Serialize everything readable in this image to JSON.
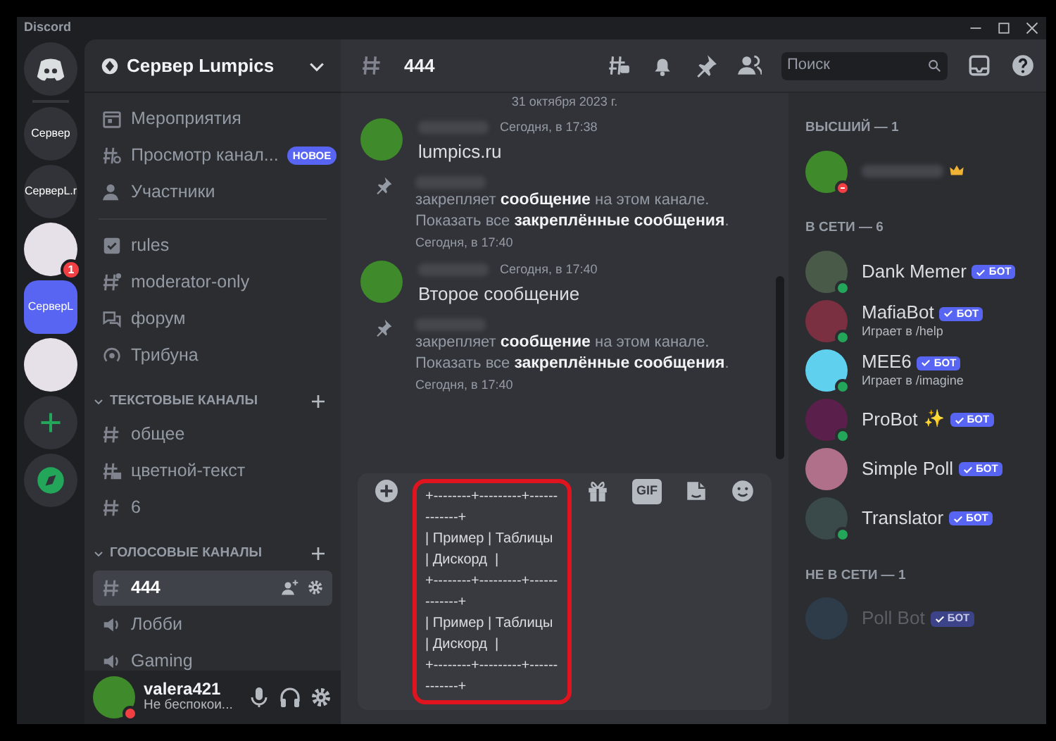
{
  "window": {
    "title": "Discord"
  },
  "servers": [
    {
      "kind": "home",
      "selected": false
    },
    {
      "kind": "text",
      "label": "Сервер",
      "selected": false
    },
    {
      "kind": "text",
      "label": "СерверL.r",
      "selected": false
    },
    {
      "kind": "image",
      "badge": "1",
      "selected": false
    },
    {
      "kind": "text",
      "label": "СерверL",
      "selected": true
    },
    {
      "kind": "image",
      "selected": false
    },
    {
      "kind": "add",
      "selected": false
    },
    {
      "kind": "explore",
      "selected": false
    }
  ],
  "server_header": {
    "name": "Сервер Lumpics"
  },
  "nav_items": [
    {
      "kind": "calendar",
      "label": "Мероприятия"
    },
    {
      "kind": "browse",
      "label": "Просмотр канал...",
      "badge": "НОВОЕ"
    },
    {
      "kind": "members",
      "label": "Участники"
    }
  ],
  "channels": [
    {
      "kind": "rules",
      "label": "rules",
      "selected": false
    },
    {
      "kind": "hidden",
      "label": "moderator-only",
      "selected": false
    },
    {
      "kind": "forum",
      "label": "форум",
      "selected": false
    },
    {
      "kind": "stage",
      "label": "Трибуна",
      "selected": false
    }
  ],
  "categories": [
    {
      "label": "ТЕКСТОВЫЕ КАНАЛЫ",
      "channels": [
        {
          "kind": "text",
          "label": "общее",
          "selected": false
        },
        {
          "kind": "locked",
          "label": "цветной-текст",
          "selected": false
        },
        {
          "kind": "text",
          "label": "6",
          "selected": false
        }
      ]
    },
    {
      "label": "ГОЛОСОВЫЕ КАНАЛЫ",
      "channels": [
        {
          "kind": "text",
          "label": "444",
          "selected": true
        },
        {
          "kind": "voice",
          "label": "Лобби",
          "selected": false
        },
        {
          "kind": "voice",
          "label": "Gaming",
          "selected": false
        }
      ]
    }
  ],
  "user_panel": {
    "name": "valera421",
    "status": "Не беспокои...",
    "dnd": true
  },
  "chat_header": {
    "channel": "444",
    "search_placeholder": "Поиск"
  },
  "date_divider": "31 октября 2023 г.",
  "messages": [
    {
      "kind": "message",
      "time": "Сегодня, в 17:38",
      "text": "lumpics.ru"
    },
    {
      "kind": "pin",
      "text": "закрепляет **сообщение** на этом канале. Показать все **закреплённые сообщения**.",
      "time": "Сегодня, в 17:40"
    },
    {
      "kind": "message",
      "time": "Сегодня, в 17:40",
      "text": "Второе сообщение"
    },
    {
      "kind": "pin",
      "text": "закрепляет **сообщение** на этом канале. Показать все **закреплённые сообщения**.",
      "time": "Сегодня, в 17:40"
    }
  ],
  "composer": {
    "highlighted": true,
    "gif": "GIF",
    "lines": [
      "+--------+---------+-------------+",
      "| Пример | Таблицы | Дискорд  |",
      "+--------+---------+-------------+",
      "| Пример | Таблицы | Дискорд  |",
      "+--------+---------+-------------+"
    ]
  },
  "member_groups": [
    {
      "label": "ВЫСШИЙ — 1",
      "members": [
        {
          "online": false,
          "dnd": true,
          "color": "#3f8a2a",
          "crown": true,
          "offline": false
        }
      ]
    },
    {
      "label": "В СЕТИ — 6",
      "members": [
        {
          "name": "Dank Memer",
          "tag": "БОТ",
          "online": true,
          "dnd": false,
          "color": "#4a5a48",
          "crown": false,
          "offline": false
        },
        {
          "name": "MafiaBot",
          "tag": "БОТ",
          "activity": "Играет в /help",
          "online": true,
          "dnd": false,
          "color": "#7a3040",
          "crown": false,
          "offline": false
        },
        {
          "name": "MEE6",
          "tag": "БОТ",
          "activity": "Играет в /imagine",
          "online": true,
          "dnd": false,
          "color": "#5fd0ee",
          "crown": false,
          "offline": false
        },
        {
          "name": "ProBot",
          "emoji": "✨",
          "tag": "БОТ",
          "online": true,
          "dnd": false,
          "color": "#5a1f4a",
          "crown": false,
          "offline": false
        },
        {
          "name": "Simple Poll",
          "tag": "БОТ",
          "online": false,
          "dnd": false,
          "color": "#b0708a",
          "crown": false,
          "offline": false
        },
        {
          "name": "Translator",
          "tag": "БОТ",
          "online": true,
          "dnd": false,
          "color": "#3a4a4a",
          "crown": false,
          "offline": false
        }
      ]
    },
    {
      "label": "НЕ В СЕТИ — 1",
      "members": [
        {
          "name": "Poll Bot",
          "tag": "БОТ",
          "online": false,
          "dnd": false,
          "color": "#2e3c4a",
          "crown": false,
          "offline": true
        }
      ]
    }
  ]
}
